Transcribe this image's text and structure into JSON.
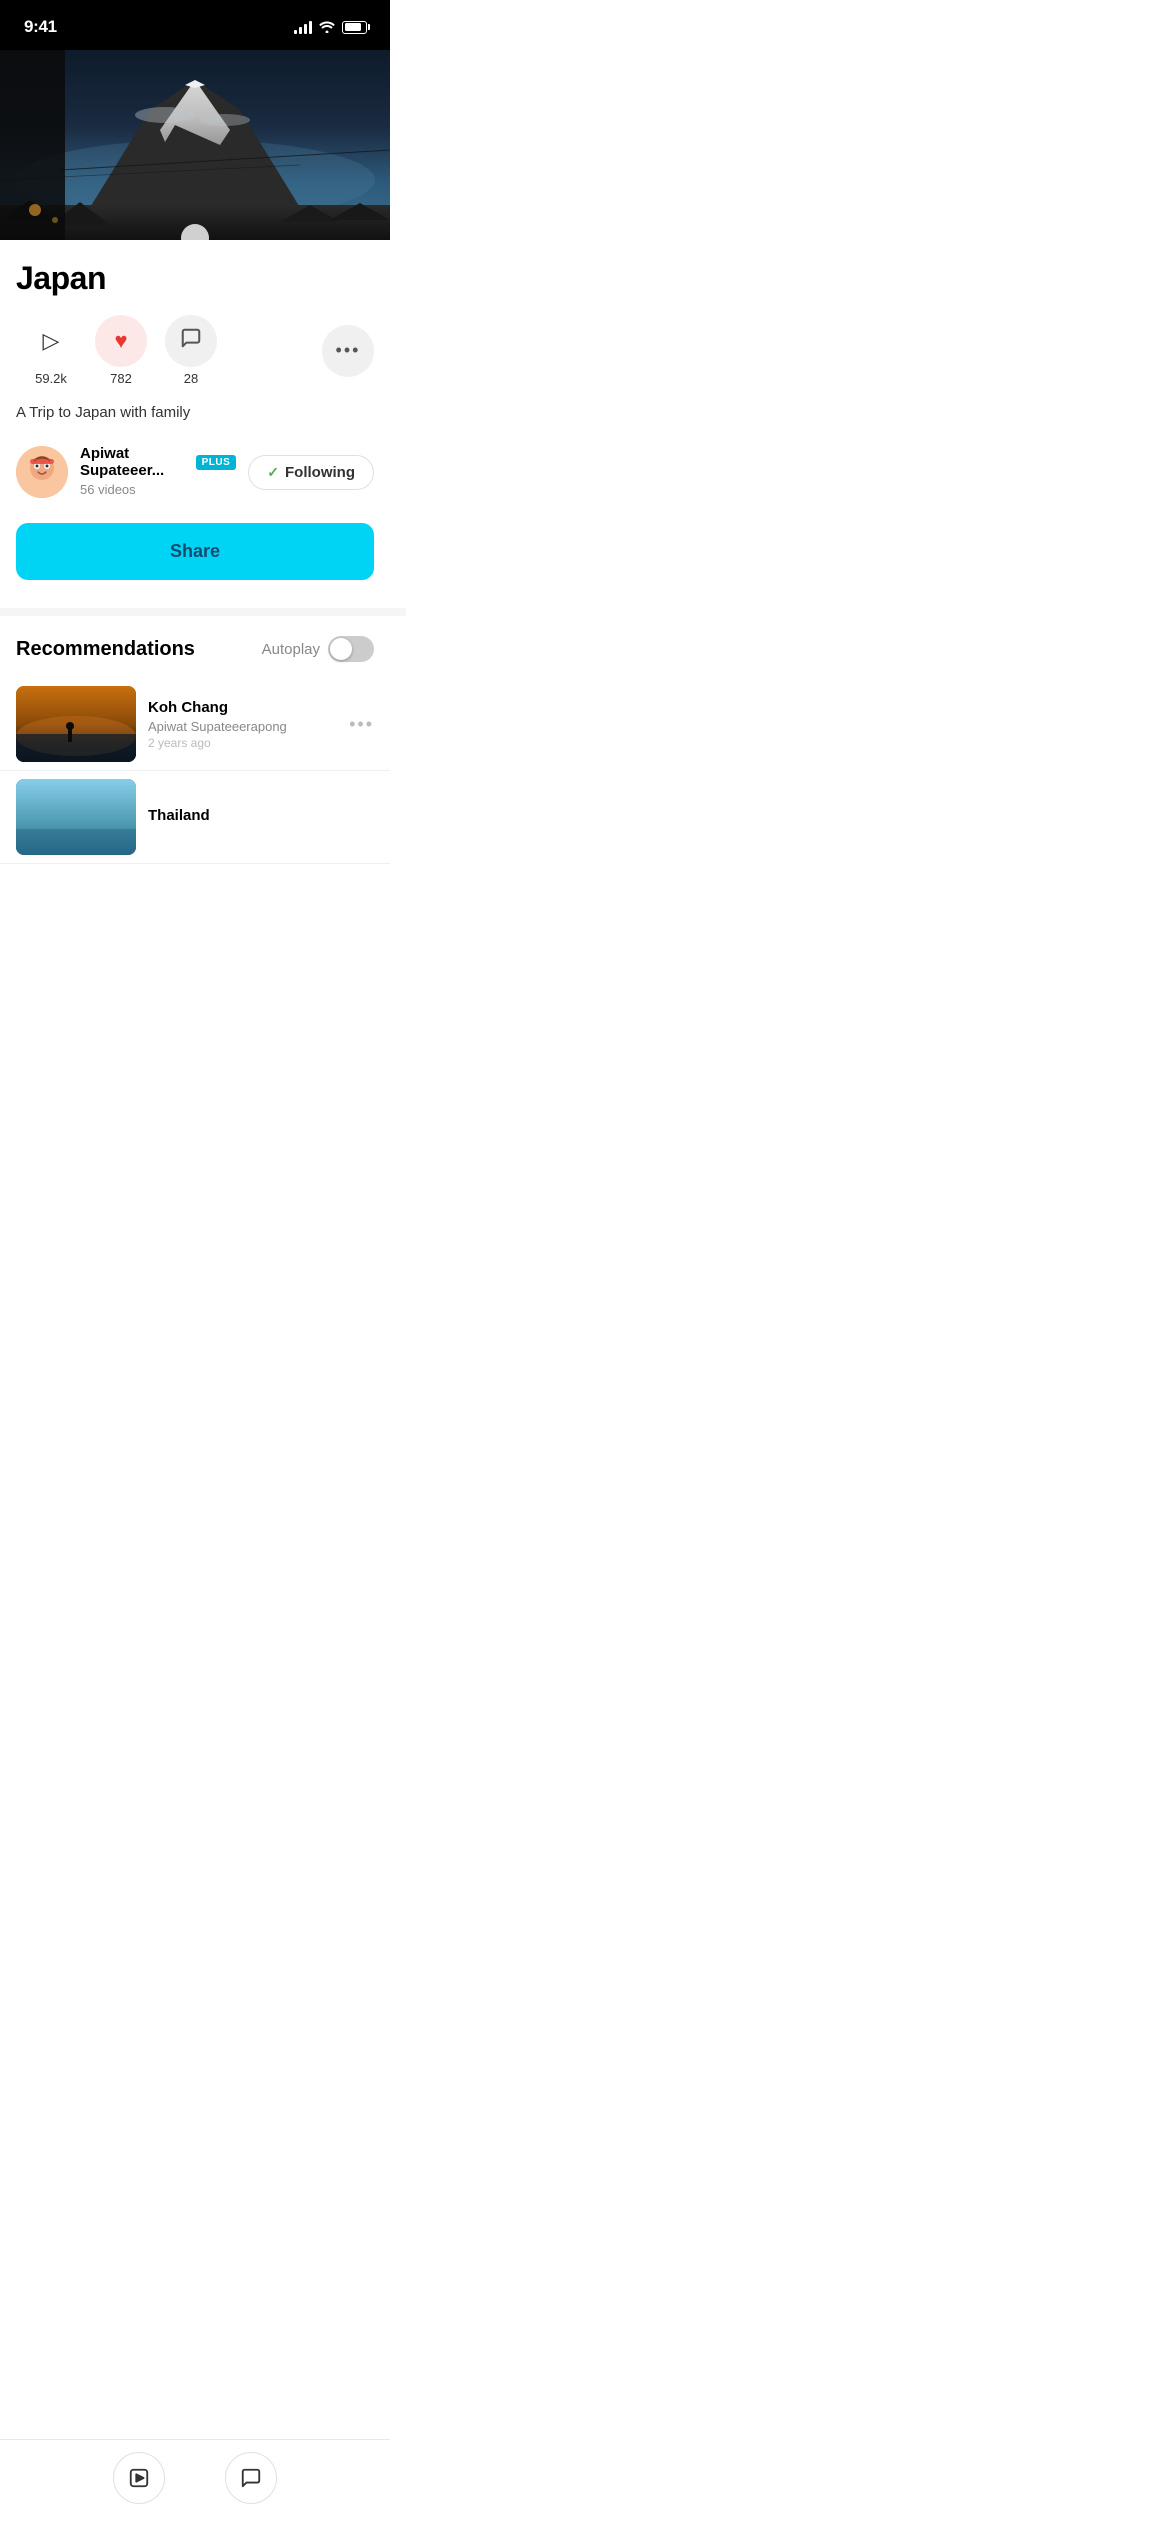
{
  "status_bar": {
    "time": "9:41",
    "signal_bars": 4,
    "wifi": true,
    "battery_pct": 80
  },
  "video": {
    "scene": "Mount Fuji with snow-capped peak, dark sky, winter landscape"
  },
  "channel": {
    "title": "Japan",
    "play_count": "59.2k",
    "like_count": "782",
    "comment_count": "28",
    "description": "A Trip to Japan with family",
    "is_liked": true
  },
  "creator": {
    "name": "Apiwat Supateeer...",
    "badge": "PLUS",
    "video_count": "56 videos",
    "following": true,
    "follow_label": "Following",
    "follow_check": "✓"
  },
  "share_button": {
    "label": "Share"
  },
  "recommendations": {
    "title": "Recommendations",
    "autoplay_label": "Autoplay",
    "autoplay_on": false,
    "items": [
      {
        "title": "Koh Chang",
        "creator": "Apiwat Supateeerapong",
        "meta": "2 years ago",
        "thumb": "koh-chang"
      },
      {
        "title": "Thailand",
        "creator": "",
        "meta": "",
        "thumb": "thailand"
      }
    ]
  },
  "bottom_tabs": [
    {
      "icon": "▶",
      "label": "play"
    },
    {
      "icon": "💬",
      "label": "comment"
    }
  ],
  "icons": {
    "play": "▷",
    "heart": "♥",
    "comment": "💬",
    "more": "•••",
    "check": "✓"
  }
}
